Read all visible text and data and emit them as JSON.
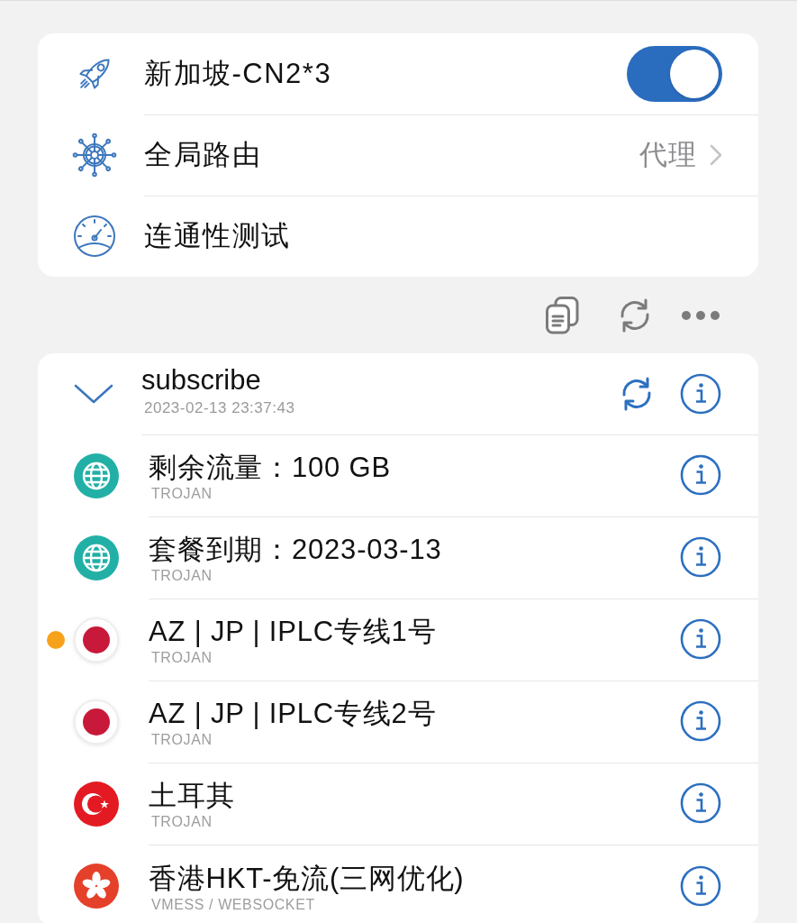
{
  "settings": {
    "rows": [
      {
        "kind": "switch",
        "label": "新加坡-CN2*3",
        "on": true
      },
      {
        "kind": "link",
        "label": "全局路由",
        "value": "代理"
      },
      {
        "kind": "action",
        "label": "连通性测试"
      }
    ]
  },
  "subscription": {
    "name": "subscribe",
    "updated": "2023-02-13 23:37:43",
    "expanded": true,
    "nodes": [
      {
        "kind": "globe",
        "name": "剩余流量：100 GB",
        "protocol": "TROJAN",
        "selected": false
      },
      {
        "kind": "globe",
        "name": "套餐到期：2023-03-13",
        "protocol": "TROJAN",
        "selected": false
      },
      {
        "kind": "japan",
        "name": "AZ | JP | IPLC专线1号",
        "protocol": "TROJAN",
        "selected": true
      },
      {
        "kind": "japan",
        "name": "AZ | JP | IPLC专线2号",
        "protocol": "TROJAN",
        "selected": false
      },
      {
        "kind": "turkey",
        "name": "土耳其",
        "protocol": "TROJAN",
        "selected": false
      },
      {
        "kind": "hongkong",
        "name": "香港HKT-免流(三网优化)",
        "protocol": "VMESS / WEBSOCKET",
        "selected": false
      }
    ]
  }
}
